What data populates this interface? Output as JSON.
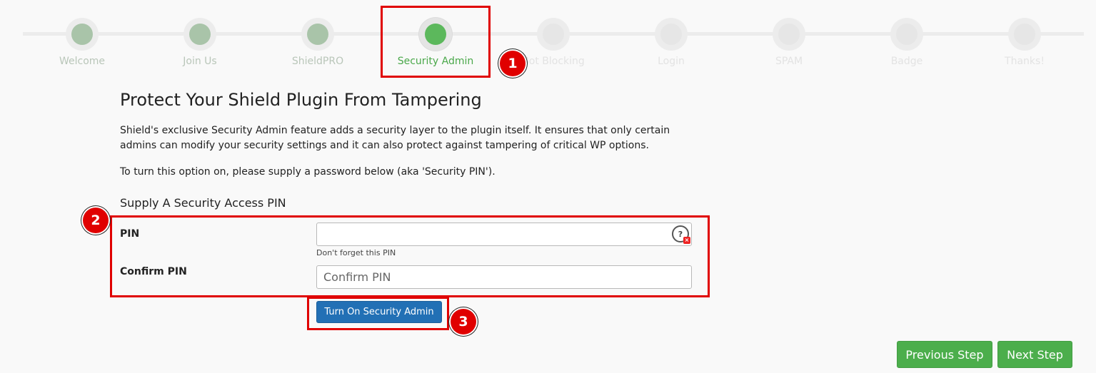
{
  "steps": [
    {
      "label": "Welcome",
      "state": "done"
    },
    {
      "label": "Join Us",
      "state": "done"
    },
    {
      "label": "ShieldPRO",
      "state": "done"
    },
    {
      "label": "Security Admin",
      "state": "active"
    },
    {
      "label": "Bot Blocking",
      "state": "pending"
    },
    {
      "label": "Login",
      "state": "pending"
    },
    {
      "label": "SPAM",
      "state": "pending"
    },
    {
      "label": "Badge",
      "state": "pending"
    },
    {
      "label": "Thanks!",
      "state": "pending"
    }
  ],
  "main": {
    "title": "Protect Your Shield Plugin From Tampering",
    "description": "Shield's exclusive Security Admin feature adds a security layer to the plugin itself. It ensures that only certain admins can modify your security settings and it can also protect against tampering of critical WP options.",
    "instruction": "To turn this option on, please supply a password below (aka 'Security PIN').",
    "section_title": "Supply A Security Access PIN"
  },
  "form": {
    "pin_label": "PIN",
    "pin_value": "",
    "pin_help": "Don't forget this PIN",
    "confirm_label": "Confirm PIN",
    "confirm_placeholder": "Confirm PIN",
    "submit_label": "Turn On Security Admin"
  },
  "nav": {
    "previous_label": "Previous Step",
    "next_label": "Next Step"
  },
  "annotations": {
    "badge_1": "1",
    "badge_2": "2",
    "badge_3": "3"
  },
  "colors": {
    "active_green": "#5cb85c",
    "done_green": "#a9c4a9",
    "primary_blue": "#2270b5",
    "annotation_red": "#e00000"
  }
}
